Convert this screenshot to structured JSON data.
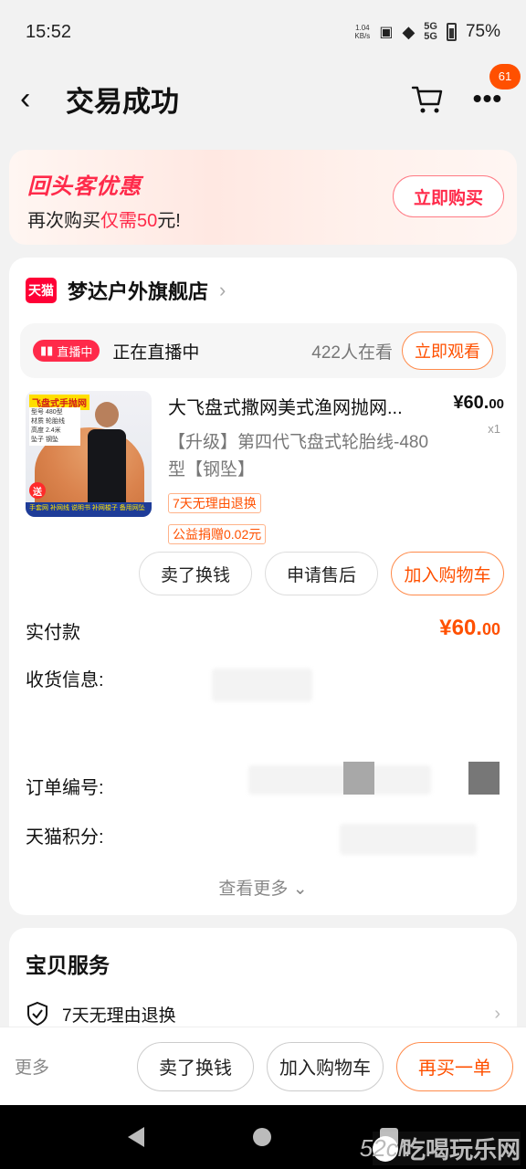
{
  "status_bar": {
    "time": "15:52",
    "net_speed_value": "1.04",
    "net_speed_unit": "KB/s",
    "sig1": "5G",
    "sig2": "5G",
    "battery": "75%"
  },
  "nav": {
    "title": "交易成功",
    "badge_count": "61",
    "back_icon": "chevron-left-icon",
    "cart_icon": "cart-icon",
    "more_icon": "more-dots-icon"
  },
  "promo": {
    "title": "回头客优惠",
    "sub_prefix": "再次购买",
    "sub_highlight": "仅需50",
    "sub_suffix": "元!",
    "button": "立即购买",
    "accent": "#ff2a4a"
  },
  "shop": {
    "logo_text": "天猫",
    "name": "梦达户外旗舰店",
    "live": {
      "tag": "直播中",
      "text": "正在直播中",
      "count": "422人在看",
      "button": "立即观看"
    }
  },
  "product": {
    "thumb_title": "飞盘式手抛网",
    "thumb_specs": [
      "型号 480型",
      "材质 轮胎线",
      "高度 2.4米",
      "坠子 钢坠"
    ],
    "thumb_send": "送",
    "thumb_bottom": "手套网 补网线 说明书 补网梭子 备用网坠",
    "title": "大飞盘式撒网美式渔网抛网...",
    "price_int": "¥60.",
    "price_dec": "00",
    "qty": "x1",
    "spec": "【升级】第四代飞盘式轮胎线-480型【钢坠】",
    "tags": [
      "7天无理由退换",
      "公益捐赠0.02元"
    ],
    "actions": {
      "sell": "卖了换钱",
      "after_sale": "申请售后",
      "add_cart": "加入购物车"
    }
  },
  "order": {
    "paid_label": "实付款",
    "paid_int": "¥60.",
    "paid_dec": "00",
    "ship_label": "收货信息:",
    "order_no_label": "订单编号:",
    "points_label": "天猫积分:",
    "see_more": "查看更多"
  },
  "service": {
    "title": "宝贝服务",
    "item": "7天无理由退换"
  },
  "bottom": {
    "more": "更多",
    "sell": "卖了换钱",
    "add_cart": "加入购物车",
    "rebuy": "再买一单",
    "brand_color": "#ff5000"
  },
  "watermark": {
    "logo": "52ch",
    "text": "吃喝玩乐网"
  }
}
